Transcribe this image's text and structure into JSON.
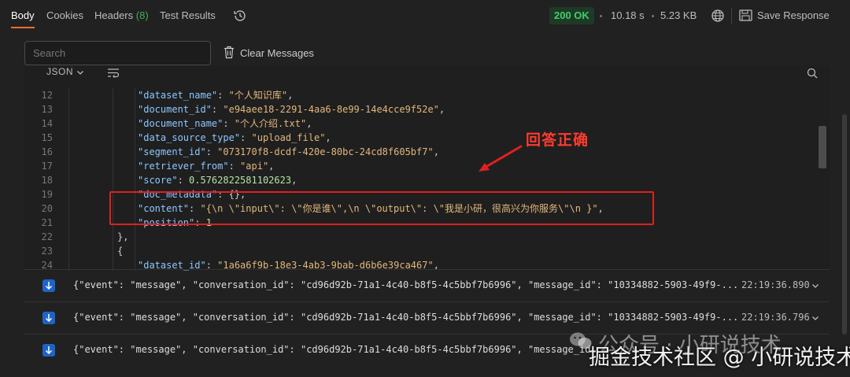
{
  "tabs": [
    {
      "label": "Body"
    },
    {
      "label": "Cookies"
    },
    {
      "label": "Headers",
      "count": "(8)"
    },
    {
      "label": "Test Results"
    }
  ],
  "status": {
    "code": "200 OK",
    "time": "10.18 s",
    "size": "5.23 KB",
    "save_label": "Save Response"
  },
  "search": {
    "placeholder": "Search",
    "clear_label": "Clear Messages"
  },
  "viewer": {
    "format": "JSON"
  },
  "code_lines": [
    {
      "n": "12",
      "text": "\"dataset_name\": \"个人知识库\","
    },
    {
      "n": "13",
      "text": "\"document_id\": \"e94aee18-2291-4aa6-8e99-14e4cce9f52e\","
    },
    {
      "n": "14",
      "text": "\"document_name\": \"个人介绍.txt\","
    },
    {
      "n": "15",
      "text": "\"data_source_type\": \"upload_file\","
    },
    {
      "n": "16",
      "text": "\"segment_id\": \"073170f8-dcdf-420e-80bc-24cd8f605bf7\","
    },
    {
      "n": "17",
      "text": "\"retriever_from\": \"api\","
    },
    {
      "n": "18",
      "text": "\"score\": 0.5762822581102623,"
    },
    {
      "n": "19",
      "text": "\"doc_metadata\": {},"
    },
    {
      "n": "20",
      "text": "\"content\": \"{\\n \\\"input\\\": \\\"你是谁\\\",\\n \\\"output\\\": \\\"我是小研，很高兴为你服务\\\"\\n }\","
    },
    {
      "n": "21",
      "text": "\"position\": 1"
    },
    {
      "n": "22",
      "text": "},"
    },
    {
      "n": "23",
      "text": "{"
    },
    {
      "n": "24",
      "text": "\"dataset_id\": \"1a6a6f9b-18e3-4ab3-9bab-d6b6e39ca467\","
    }
  ],
  "annotation": {
    "label": "回答正确"
  },
  "messages": [
    {
      "text": "{\"event\": \"message\", \"conversation_id\": \"cd96d92b-71a1-4c40-b8f5-4c5bbf7b6996\", \"message_id\": \"10334882-5903-49f9-...",
      "time": "22:19:36.890"
    },
    {
      "text": "{\"event\": \"message\", \"conversation_id\": \"cd96d92b-71a1-4c40-b8f5-4c5bbf7b6996\", \"message_id\": \"10334882-5903-49f9-...",
      "time": "22:19:36.796"
    },
    {
      "text": "{\"event\": \"message\", \"conversation_id\": \"cd96d92b-71a1-4c40-b8f5-4c5bbf7b6996\", \"message_id",
      "time": ""
    }
  ],
  "watermarks": {
    "line1": "公众号 · 小研说技术",
    "line2": "掘金技术社区 @ 小研说技术"
  },
  "colors": {
    "accent": "#ff6c37",
    "success": "#3fcf6a",
    "annotation": "#e02020",
    "key": "#8ec7ff",
    "string": "#e3b77d"
  }
}
